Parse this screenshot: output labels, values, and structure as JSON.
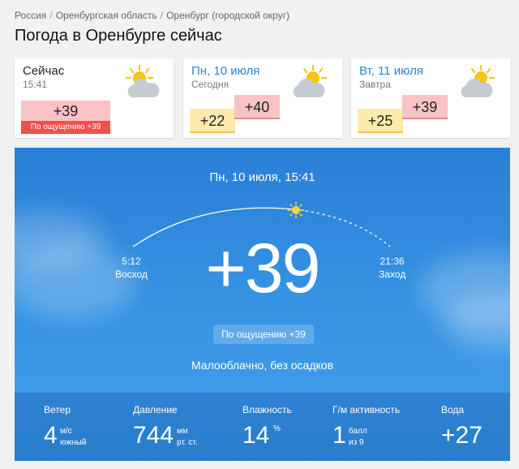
{
  "breadcrumb": {
    "items": [
      "Россия",
      "Оренбургская область",
      "Оренбург (городской округ)"
    ]
  },
  "page_title": "Погода в Оренбурге сейчас",
  "now_card": {
    "title": "Сейчас",
    "time": "15:41",
    "temp": "+39",
    "feels": "По ощущению +39",
    "icon": "partly-cloudy-icon"
  },
  "day_cards": [
    {
      "title": "Пн, 10 июля",
      "sub": "Сегодня",
      "low": "+22",
      "high": "+40",
      "icon": "partly-cloudy-icon"
    },
    {
      "title": "Вт, 11 июля",
      "sub": "Завтра",
      "low": "+25",
      "high": "+39",
      "icon": "partly-cloudy-icon"
    }
  ],
  "main": {
    "datetime": "Пн, 10 июля, 15:41",
    "sunrise_time": "5:12",
    "sunrise_label": "Восход",
    "sunset_time": "21:36",
    "sunset_label": "Заход",
    "temp": "+39",
    "feels": "По ощущению +39",
    "condition": "Малооблачно, без осадков"
  },
  "stats": {
    "wind": {
      "label": "Ветер",
      "value": "4",
      "unit1": "м/с",
      "unit2": "южный"
    },
    "pressure": {
      "label": "Давление",
      "value": "744",
      "unit1": "мм",
      "unit2": "рт. ст."
    },
    "humidity": {
      "label": "Влажность",
      "value": "14",
      "unit1": "%",
      "unit2": ""
    },
    "geomag": {
      "label": "Г/м активность",
      "value": "1",
      "unit1": "балл",
      "unit2": "из 9"
    },
    "water": {
      "label": "Вода",
      "value": "+27"
    }
  },
  "colors": {
    "accent_blue": "#2a86d8",
    "temp_hot": "#fbc3c3",
    "temp_warm": "#fdeaae",
    "feels_red": "#f0504a"
  }
}
